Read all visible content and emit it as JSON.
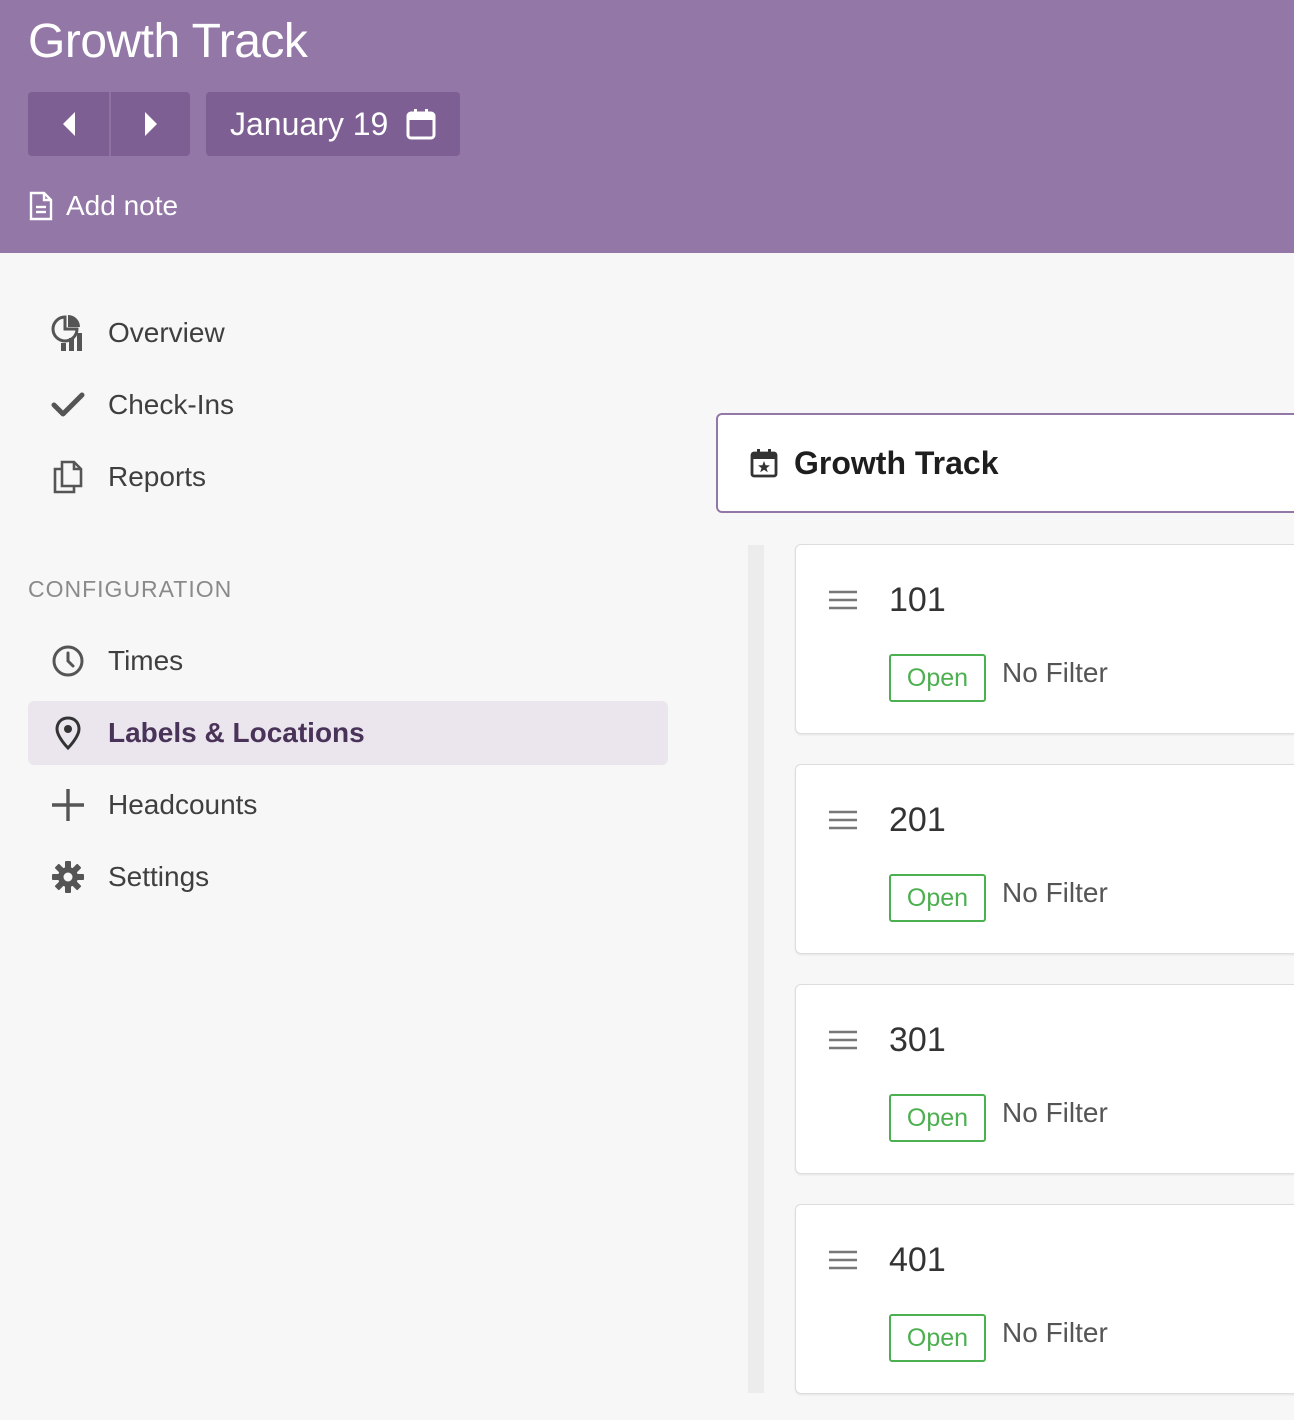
{
  "header": {
    "title": "Growth Track",
    "date_label": "January 19",
    "add_note_label": "Add note",
    "icons": [
      "caret-left-icon",
      "caret-right-icon",
      "calendar-icon",
      "note-icon"
    ]
  },
  "sidebar": {
    "primary": [
      {
        "label": "Overview",
        "icon": "chart-pie-icon"
      },
      {
        "label": "Check-Ins",
        "icon": "check-icon"
      },
      {
        "label": "Reports",
        "icon": "copy-icon"
      }
    ],
    "section_label": "CONFIGURATION",
    "config": [
      {
        "label": "Times",
        "icon": "clock-icon"
      },
      {
        "label": "Labels & Locations",
        "icon": "map-pin-icon",
        "active": true
      },
      {
        "label": "Headcounts",
        "icon": "plus-icon"
      },
      {
        "label": "Settings",
        "icon": "gear-icon"
      }
    ]
  },
  "main": {
    "track_title": "Growth Track",
    "track_icon": "calendar-star-icon",
    "locations": [
      {
        "name": "101",
        "status": "Open",
        "filter": "No Filter"
      },
      {
        "name": "201",
        "status": "Open",
        "filter": "No Filter"
      },
      {
        "name": "301",
        "status": "Open",
        "filter": "No Filter"
      },
      {
        "name": "401",
        "status": "Open",
        "filter": "No Filter"
      }
    ]
  },
  "colors": {
    "header_bg": "#9377a6",
    "button_bg": "#7d5f93",
    "active_bg": "#ebe6ee",
    "open_green": "#4caf50"
  }
}
